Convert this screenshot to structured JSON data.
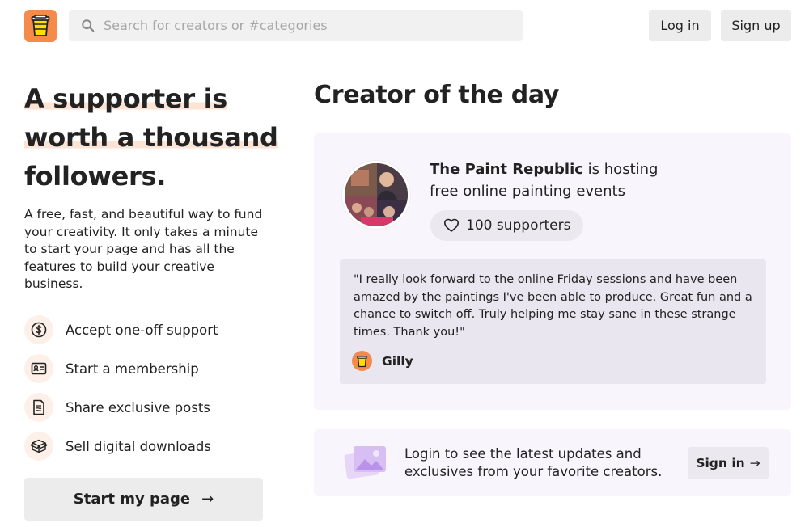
{
  "header": {
    "search_placeholder": "Search for creators or #categories",
    "login_label": "Log in",
    "signup_label": "Sign up"
  },
  "hero": {
    "headline_line1": "A supporter is",
    "headline_line2": "worth a thousand",
    "headline_line3": "followers.",
    "subtext": "A free, fast, and beautiful way to fund your creativity. It only takes a minute to start your page and has all the features to build your creative business."
  },
  "features": [
    {
      "icon": "dollar-coin-icon",
      "label": "Accept one-off support"
    },
    {
      "icon": "membership-card-icon",
      "label": "Start a membership"
    },
    {
      "icon": "document-icon",
      "label": "Share exclusive posts"
    },
    {
      "icon": "box-icon",
      "label": "Sell digital downloads"
    }
  ],
  "cta": {
    "start_label": "Start my page",
    "arrow": "→"
  },
  "creator_of_day": {
    "title": "Creator of the day",
    "creator_name": "The Paint Republic",
    "description": " is hosting free online painting events",
    "supporters": "100 supporters",
    "quote": "\"I really look forward to the online Friday sessions and have been amazed by the paintings I've been able to produce. Great fun and a chance to switch off. Truly helping me stay sane in these strange times. Thank you!\"",
    "quote_author": "Gilly"
  },
  "login_prompt": {
    "text": "Login to see the latest updates and exclusives from your favorite creators.",
    "signin_label": "Sign in",
    "arrow": "→"
  },
  "colors": {
    "brand_orange": "#f58a4b",
    "highlight": "#fde3d4",
    "card_bg": "#f8f5fd",
    "button_bg": "#ececec"
  }
}
